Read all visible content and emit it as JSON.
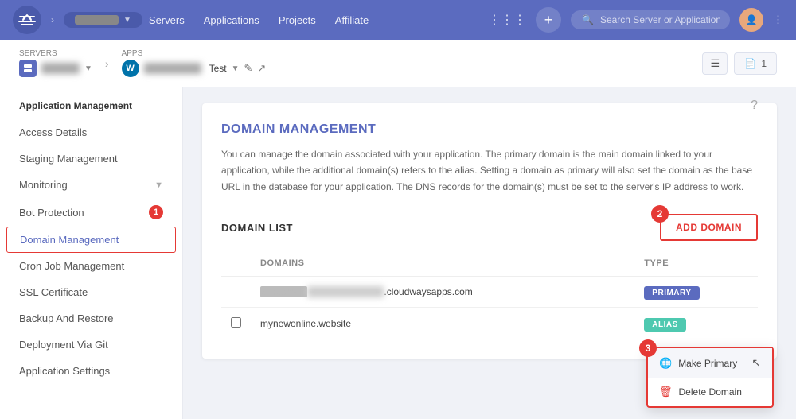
{
  "nav": {
    "links": [
      "Servers",
      "Applications",
      "Projects",
      "Affiliate"
    ],
    "search_placeholder": "Search Server or Application",
    "plus": "+"
  },
  "breadcrumb": {
    "servers_label": "Servers",
    "server_name": "BLURRED",
    "apps_label": "Apps",
    "app_name": "BLURRED",
    "app_env": "Test",
    "file_count": "1"
  },
  "sidebar": {
    "section_title": "Application Management",
    "items": [
      {
        "label": "Access Details",
        "active": false
      },
      {
        "label": "Staging Management",
        "active": false
      },
      {
        "label": "Monitoring",
        "active": false,
        "has_caret": true
      },
      {
        "label": "Bot Protection",
        "active": false,
        "badge": "1"
      },
      {
        "label": "Domain Management",
        "active": true
      },
      {
        "label": "Cron Job Management",
        "active": false
      },
      {
        "label": "SSL Certificate",
        "active": false
      },
      {
        "label": "Backup And Restore",
        "active": false
      },
      {
        "label": "Deployment Via Git",
        "active": false
      },
      {
        "label": "Application Settings",
        "active": false
      }
    ]
  },
  "domain_management": {
    "title": "DOMAIN MANAGEMENT",
    "description": "You can manage the domain associated with your application. The primary domain is the main domain linked to your application, while the additional domain(s) refers to the alias. Setting a domain as primary will also set the domain as the base URL in the database for your application. The DNS records for the domain(s) must be set to the server's IP address to work.",
    "list_title": "DOMAIN LIST",
    "add_domain_btn": "ADD DOMAIN",
    "columns": {
      "checkbox": "",
      "domains": "DOMAINS",
      "type": "TYPE"
    },
    "rows": [
      {
        "domain": "wordpress-BLURRED.cloudwaysapps.com",
        "type": "PRIMARY"
      },
      {
        "domain": "mynewonline.website",
        "type": "ALIAS"
      }
    ]
  },
  "context_menu": {
    "make_primary": "Make Primary",
    "delete_domain": "Delete Domain"
  },
  "step_badges": {
    "badge1": "1",
    "badge2": "2",
    "badge3": "3"
  }
}
